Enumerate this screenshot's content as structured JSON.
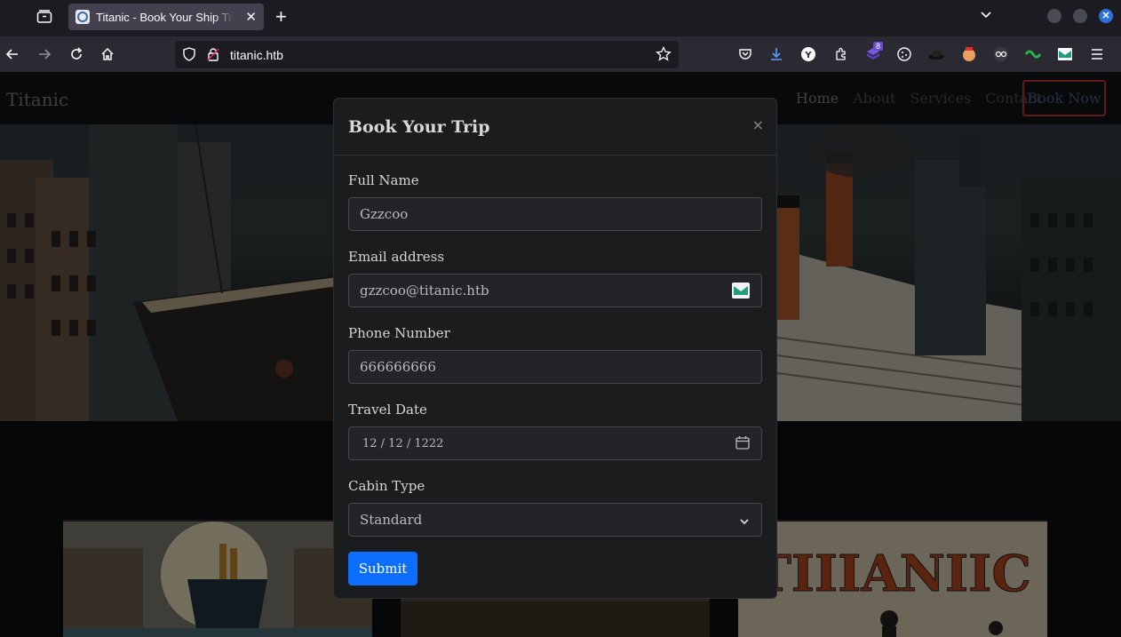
{
  "browser": {
    "tab_title": "Titanic - Book Your Ship Trip",
    "tab_close": "✕",
    "new_tab": "+",
    "url": "titanic.htb",
    "extension_badge": "8",
    "window_close": "✕"
  },
  "site": {
    "brand": "Titanic",
    "nav": [
      "Home",
      "About",
      "Services",
      "Contact"
    ],
    "book_now": "Book Now"
  },
  "modal": {
    "title": "Book Your Trip",
    "close": "×",
    "fields": {
      "full_name": {
        "label": "Full Name",
        "value": "Gzzcoo"
      },
      "email": {
        "label": "Email address",
        "value": "gzzcoo@titanic.htb"
      },
      "phone": {
        "label": "Phone Number",
        "value": "666666666"
      },
      "date": {
        "label": "Travel Date",
        "value": "12 / 12 / 1222"
      },
      "cabin": {
        "label": "Cabin Type",
        "value": "Standard"
      }
    },
    "submit": "Submit"
  },
  "icons": {
    "email_field": "mail-extension-icon",
    "date_field": "calendar-icon",
    "cabin_field": "chevron-down-icon"
  },
  "colors": {
    "primary_button": "#0d6efd",
    "book_now_border": "#c7313a",
    "modal_bg": "#1b1c1e"
  }
}
